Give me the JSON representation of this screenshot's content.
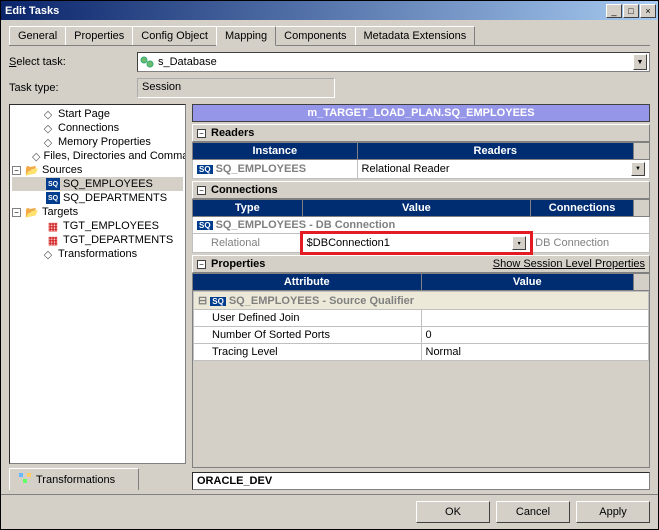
{
  "window": {
    "title": "Edit Tasks"
  },
  "tabs": [
    "General",
    "Properties",
    "Config Object",
    "Mapping",
    "Components",
    "Metadata Extensions"
  ],
  "active_tab": 3,
  "select_task": {
    "label": "Select task:",
    "value": "s_Database"
  },
  "task_type": {
    "label": "Task type:",
    "value": "Session"
  },
  "tree": {
    "items": [
      {
        "label": "Start Page",
        "icon": "doc"
      },
      {
        "label": "Connections",
        "icon": "doc"
      },
      {
        "label": "Memory Properties",
        "icon": "doc"
      },
      {
        "label": "Files, Directories and Commands",
        "icon": "doc"
      }
    ],
    "sources": {
      "label": "Sources",
      "children": [
        {
          "label": "SQ_EMPLOYEES",
          "icon": "sq",
          "selected": true
        },
        {
          "label": "SQ_DEPARTMENTS",
          "icon": "sq"
        }
      ]
    },
    "targets": {
      "label": "Targets",
      "children": [
        {
          "label": "TGT_EMPLOYEES",
          "icon": "tgt"
        },
        {
          "label": "TGT_DEPARTMENTS",
          "icon": "tgt"
        }
      ]
    },
    "transformations": {
      "label": "Transformations",
      "icon": "doc"
    }
  },
  "mapping_title": "m_TARGET_LOAD_PLAN.SQ_EMPLOYEES",
  "readers": {
    "header": "Readers",
    "cols": [
      "Instance",
      "Readers"
    ],
    "instance": "SQ_EMPLOYEES",
    "reader": "Relational Reader"
  },
  "connections": {
    "header": "Connections",
    "cols": [
      "Type",
      "Value",
      "Connections"
    ],
    "group": "SQ_EMPLOYEES - DB Connection",
    "type": "Relational",
    "value": "$DBConnection1",
    "conn": "DB Connection"
  },
  "properties": {
    "header": "Properties",
    "link": "Show Session Level Properties",
    "cols": [
      "Attribute",
      "Value"
    ],
    "group": "SQ_EMPLOYEES - Source Qualifier",
    "rows": [
      {
        "attr": "User Defined Join",
        "val": ""
      },
      {
        "attr": "Number Of Sorted Ports",
        "val": "0"
      },
      {
        "attr": "Tracing Level",
        "val": "Normal"
      }
    ]
  },
  "bottom_tab": "Transformations",
  "status": "ORACLE_DEV",
  "buttons": {
    "ok": "OK",
    "cancel": "Cancel",
    "apply": "Apply"
  }
}
